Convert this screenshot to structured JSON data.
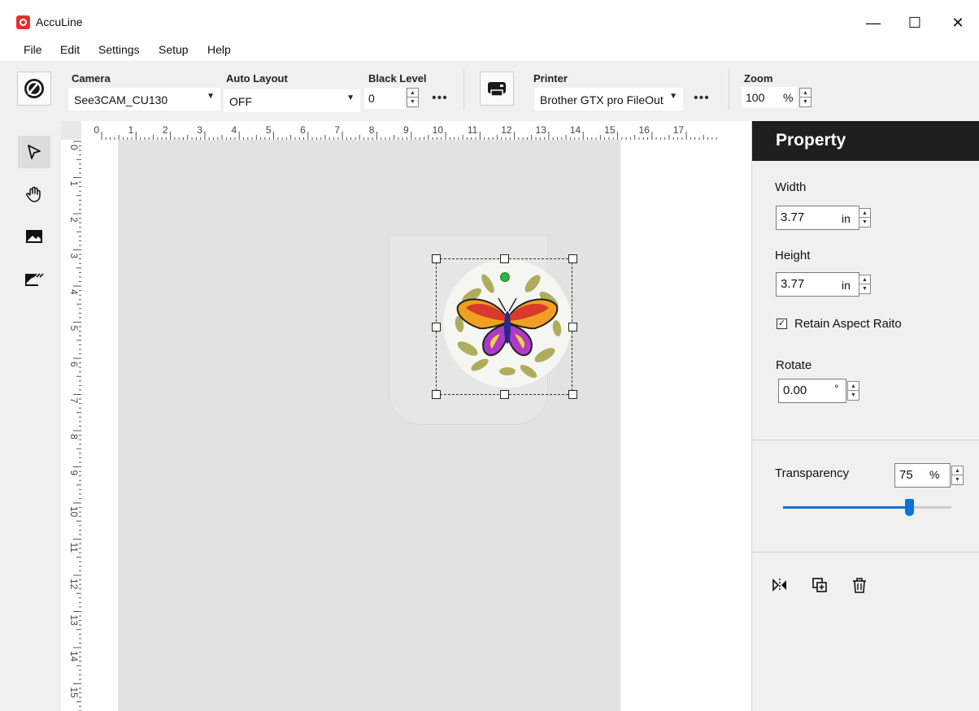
{
  "window": {
    "title": "AccuLine",
    "min_glyph": "—",
    "max_glyph": "☐",
    "close_glyph": "✕"
  },
  "menu": [
    "File",
    "Edit",
    "Settings",
    "Setup",
    "Help"
  ],
  "toolbar": {
    "camera": {
      "label": "Camera",
      "value": "See3CAM_CU130"
    },
    "auto_layout": {
      "label": "Auto Layout",
      "value": "OFF"
    },
    "black_level": {
      "label": "Black Level",
      "value": "0"
    },
    "printer": {
      "label": "Printer",
      "value": "Brother GTX pro FileOut"
    },
    "zoom": {
      "label": "Zoom",
      "value": "100",
      "unit": "%"
    },
    "more": "•••"
  },
  "tools": [
    "select-arrow",
    "hand",
    "image",
    "image-remove"
  ],
  "ruler": {
    "horizontal": [
      "0",
      "1",
      "2",
      "3",
      "4",
      "5",
      "6",
      "7",
      "8",
      "9",
      "10",
      "11",
      "12",
      "13",
      "14",
      "15",
      "16",
      "17"
    ],
    "vertical": [
      "0",
      "1",
      "2",
      "3",
      "4",
      "5",
      "6",
      "7",
      "8",
      "9",
      "10",
      "11",
      "12",
      "13",
      "14",
      "15"
    ]
  },
  "property": {
    "title": "Property",
    "width": {
      "label": "Width",
      "value": "3.77",
      "unit": "in"
    },
    "height": {
      "label": "Height",
      "value": "3.77",
      "unit": "in"
    },
    "retain_aspect": {
      "label": "Retain Aspect Raito",
      "checked": true,
      "check_glyph": "✓"
    },
    "rotate": {
      "label": "Rotate",
      "value": "0.00",
      "unit": "°"
    },
    "transparency": {
      "label": "Transparency",
      "value": "75",
      "unit": "%",
      "fraction": 0.75
    },
    "actions": [
      "flip-horizontal-icon",
      "duplicate-icon",
      "delete-icon"
    ]
  },
  "colors": {
    "accent": "#0a74da",
    "header": "#1f1f1f",
    "rotate_handle": "#2db43d",
    "app_icon": "#e0312f"
  }
}
